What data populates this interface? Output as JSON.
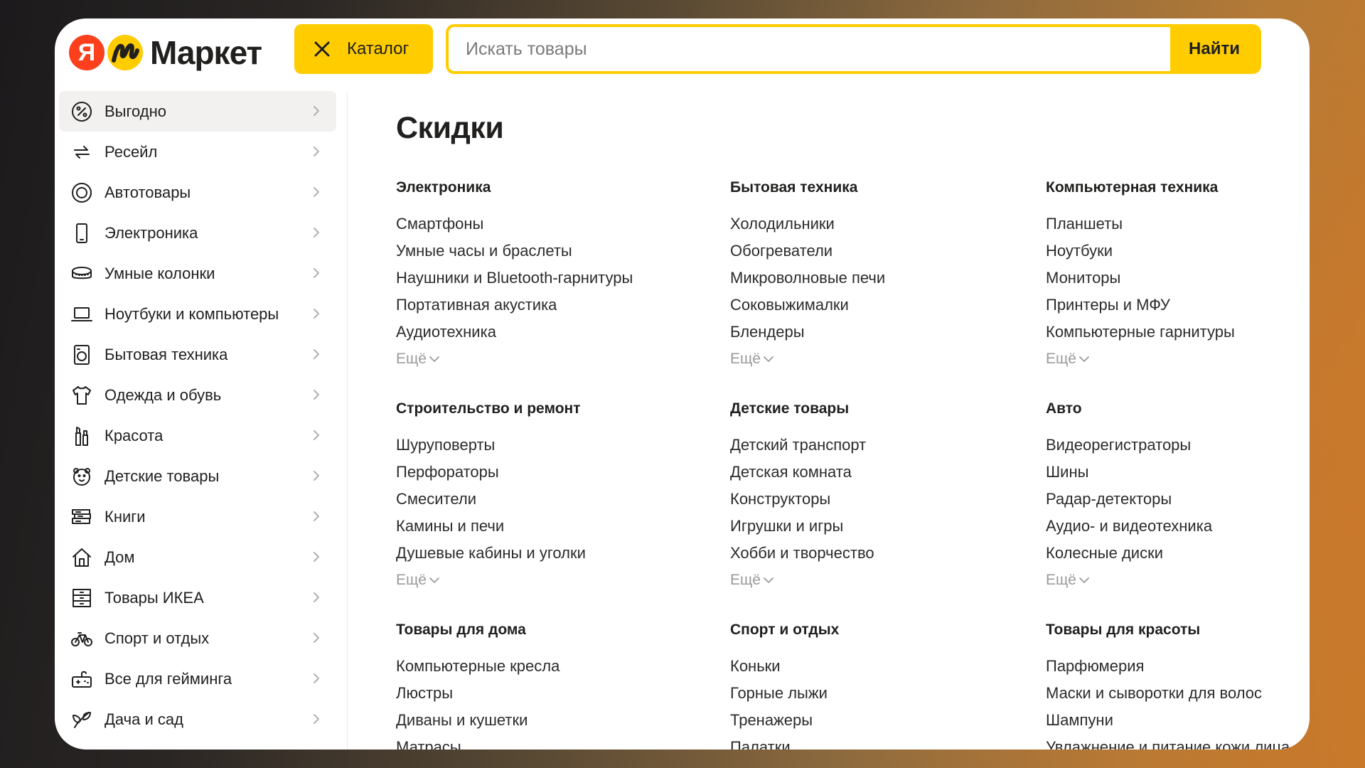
{
  "app": {
    "logo_ya": "Я",
    "logo_text": "Маркет",
    "brand_colors": {
      "yellow": "#ffcc00",
      "red": "#fc3f1d"
    }
  },
  "header": {
    "catalog_label": "Каталог",
    "search_placeholder": "Искать товары",
    "search_value": "",
    "search_button": "Найти"
  },
  "sidebar": {
    "items": [
      {
        "label": "Выгодно",
        "icon": "percent-icon",
        "active": true
      },
      {
        "label": "Ресейл",
        "icon": "resale-arrows-icon"
      },
      {
        "label": "Автотовары",
        "icon": "tire-icon"
      },
      {
        "label": "Электроника",
        "icon": "smartphone-icon"
      },
      {
        "label": "Умные колонки",
        "icon": "smart-speaker-icon"
      },
      {
        "label": "Ноутбуки и компьютеры",
        "icon": "laptop-icon"
      },
      {
        "label": "Бытовая техника",
        "icon": "washing-machine-icon"
      },
      {
        "label": "Одежда и обувь",
        "icon": "shirt-icon"
      },
      {
        "label": "Красота",
        "icon": "cosmetics-icon"
      },
      {
        "label": "Детские товары",
        "icon": "teddy-bear-icon"
      },
      {
        "label": "Книги",
        "icon": "books-icon"
      },
      {
        "label": "Дом",
        "icon": "house-icon"
      },
      {
        "label": "Товары ИКЕА",
        "icon": "cabinet-icon"
      },
      {
        "label": "Спорт и отдых",
        "icon": "bicycle-icon"
      },
      {
        "label": "Все для гейминга",
        "icon": "gamepad-icon"
      },
      {
        "label": "Дача и сад",
        "icon": "plant-icon"
      }
    ]
  },
  "main": {
    "title": "Скидки",
    "more_label": "Ещё",
    "groups": [
      {
        "title": "Электроника",
        "links": [
          "Смартфоны",
          "Умные часы и браслеты",
          "Наушники и Bluetooth-гарнитуры",
          "Портативная акустика",
          "Аудиотехника"
        ],
        "more": true
      },
      {
        "title": "Бытовая техника",
        "links": [
          "Холодильники",
          "Обогреватели",
          "Микроволновые печи",
          "Соковыжималки",
          "Блендеры"
        ],
        "more": true
      },
      {
        "title": "Компьютерная техника",
        "links": [
          "Планшеты",
          "Ноутбуки",
          "Мониторы",
          "Принтеры и МФУ",
          "Компьютерные гарнитуры"
        ],
        "more": true
      },
      {
        "title": "Строительство и ремонт",
        "links": [
          "Шуруповерты",
          "Перфораторы",
          "Смесители",
          "Камины и печи",
          "Душевые кабины и уголки"
        ],
        "more": true
      },
      {
        "title": "Детские товары",
        "links": [
          "Детский транспорт",
          "Детская комната",
          "Конструкторы",
          "Игрушки и игры",
          "Хобби и творчество"
        ],
        "more": true
      },
      {
        "title": "Авто",
        "links": [
          "Видеорегистраторы",
          "Шины",
          "Радар-детекторы",
          "Аудио- и видеотехника",
          "Колесные диски"
        ],
        "more": true
      },
      {
        "title": "Товары для дома",
        "links": [
          "Компьютерные кресла",
          "Люстры",
          "Диваны и кушетки",
          "Матрасы"
        ],
        "more": false
      },
      {
        "title": "Спорт и отдых",
        "links": [
          "Коньки",
          "Горные лыжи",
          "Тренажеры",
          "Палатки"
        ],
        "more": false
      },
      {
        "title": "Товары для красоты",
        "links": [
          "Парфюмерия",
          "Маски и сыворотки для волос",
          "Шампуни",
          "Увлажнение и питание кожи лица"
        ],
        "more": false
      }
    ]
  }
}
